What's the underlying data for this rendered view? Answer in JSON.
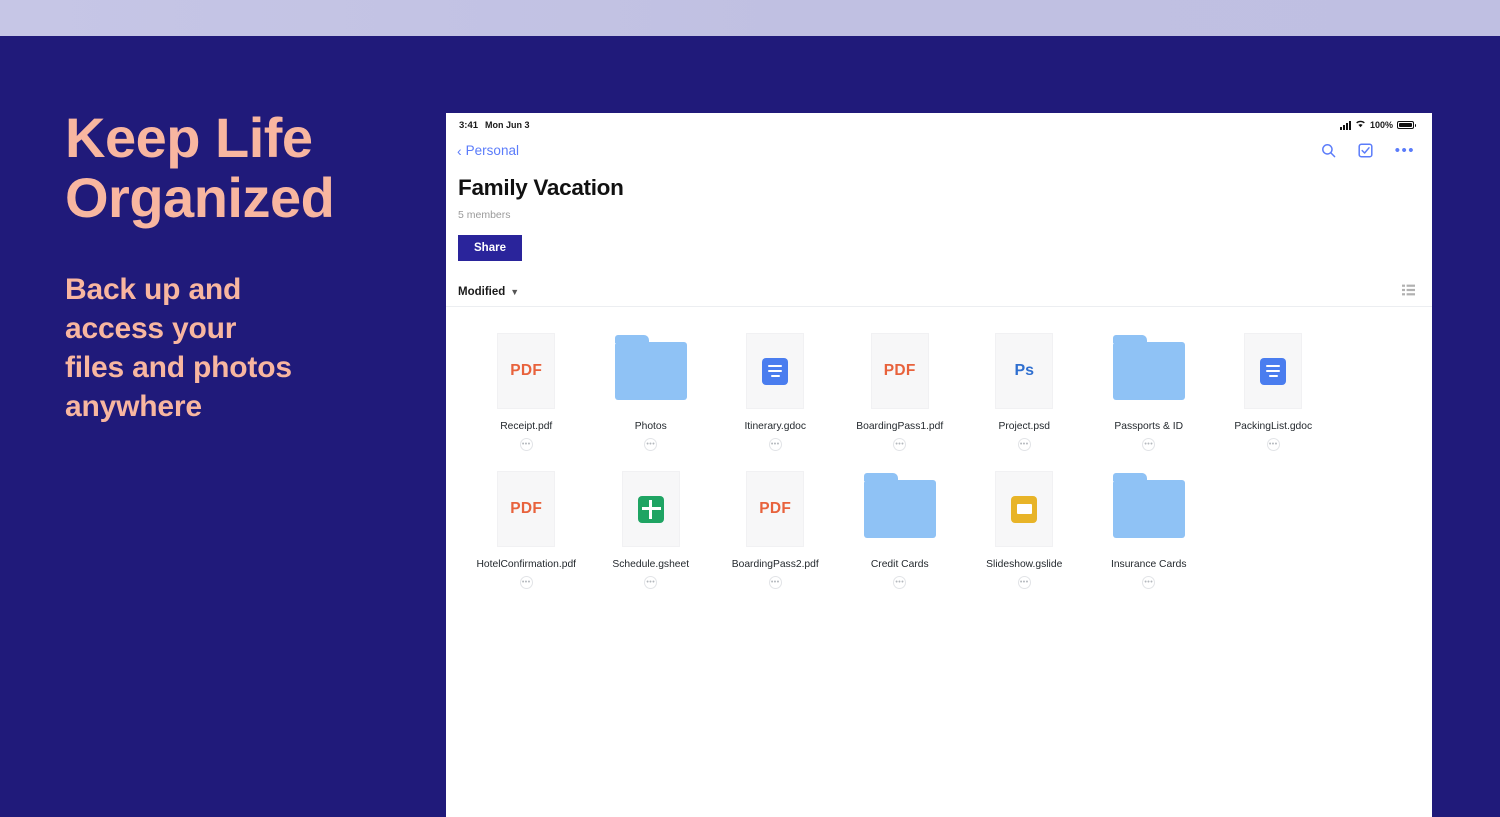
{
  "promo": {
    "headline_line1": "Keep Life",
    "headline_line2": "Organized",
    "sub_line1": "Back up and",
    "sub_line2": "access your",
    "sub_line3": "files and photos",
    "sub_line4": "anywhere",
    "text_color": "#f8b6a0",
    "background_color": "#201a7a"
  },
  "statusbar": {
    "time": "3:41",
    "date": "Mon Jun 3",
    "battery_percent": "100%",
    "signal_icon": "cellular-bars-icon",
    "wifi_icon": "wifi-icon",
    "battery_icon": "battery-icon"
  },
  "nav": {
    "back_label": "Personal",
    "back_icon": "chevron-left-icon",
    "search_icon": "search-icon",
    "select_icon": "checkbox-select-icon",
    "more_icon": "ellipsis-icon",
    "accent_color": "#5b7cfa"
  },
  "header": {
    "title": "Family Vacation",
    "members": "5 members",
    "share_label": "Share",
    "share_color": "#2a249b"
  },
  "sortbar": {
    "sort_label": "Modified",
    "chevron_icon": "chevron-down-icon",
    "view_icon": "list-view-icon"
  },
  "files": [
    {
      "name": "Receipt.pdf",
      "kind": "pdf",
      "badge": "PDF",
      "menu": "..."
    },
    {
      "name": "Photos",
      "kind": "folder",
      "badge": "",
      "menu": "..."
    },
    {
      "name": "Itinerary.gdoc",
      "kind": "gdoc",
      "badge": "",
      "menu": "..."
    },
    {
      "name": "BoardingPass1.pdf",
      "kind": "pdf",
      "badge": "PDF",
      "menu": "..."
    },
    {
      "name": "Project.psd",
      "kind": "psd",
      "badge": "Ps",
      "menu": "..."
    },
    {
      "name": "Passports & ID",
      "kind": "folder",
      "badge": "",
      "menu": "..."
    },
    {
      "name": "PackingList.gdoc",
      "kind": "gdoc",
      "badge": "",
      "menu": "..."
    },
    {
      "name": "HotelConfirmation.pdf",
      "kind": "pdf",
      "badge": "PDF",
      "menu": "..."
    },
    {
      "name": "Schedule.gsheet",
      "kind": "gsheet",
      "badge": "",
      "menu": "..."
    },
    {
      "name": "BoardingPass2.pdf",
      "kind": "pdf",
      "badge": "PDF",
      "menu": "..."
    },
    {
      "name": "Credit Cards",
      "kind": "folder",
      "badge": "",
      "menu": "..."
    },
    {
      "name": "Slideshow.gslide",
      "kind": "gslide",
      "badge": "",
      "menu": "..."
    },
    {
      "name": "Insurance Cards",
      "kind": "folder",
      "badge": "",
      "menu": "..."
    }
  ]
}
